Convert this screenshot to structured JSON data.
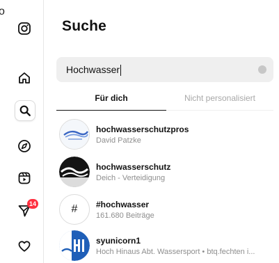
{
  "edge_fragment": "o",
  "nav": {
    "icons": [
      "instagram-logo-icon",
      "home-icon",
      "search-icon",
      "explore-compass-icon",
      "reels-icon",
      "messages-icon",
      "notifications-heart-icon"
    ],
    "messages_badge": "14"
  },
  "panel": {
    "title": "Suche",
    "search": {
      "value": "Hochwasser"
    },
    "tabs": [
      {
        "label": "Für dich",
        "active": true
      },
      {
        "label": "Nicht personalisiert",
        "active": false
      }
    ],
    "results": [
      {
        "title": "hochwasserschutzpros",
        "subtitle": "David Patzke"
      },
      {
        "title": "hochwasserschutz",
        "subtitle": "Deich - Verteidigung"
      },
      {
        "title": "#hochwasser",
        "subtitle": "161.680 Beiträge",
        "avatar_text": "#"
      },
      {
        "title": "syunicorn1",
        "subtitle": "Hoch Hinaus Abt. Wassersport • btq.fechten i..."
      }
    ]
  },
  "colors": {
    "badge": "#ff3040",
    "active_tab": "#111111",
    "muted": "#8e8e8e",
    "search_bg": "#efefef"
  }
}
